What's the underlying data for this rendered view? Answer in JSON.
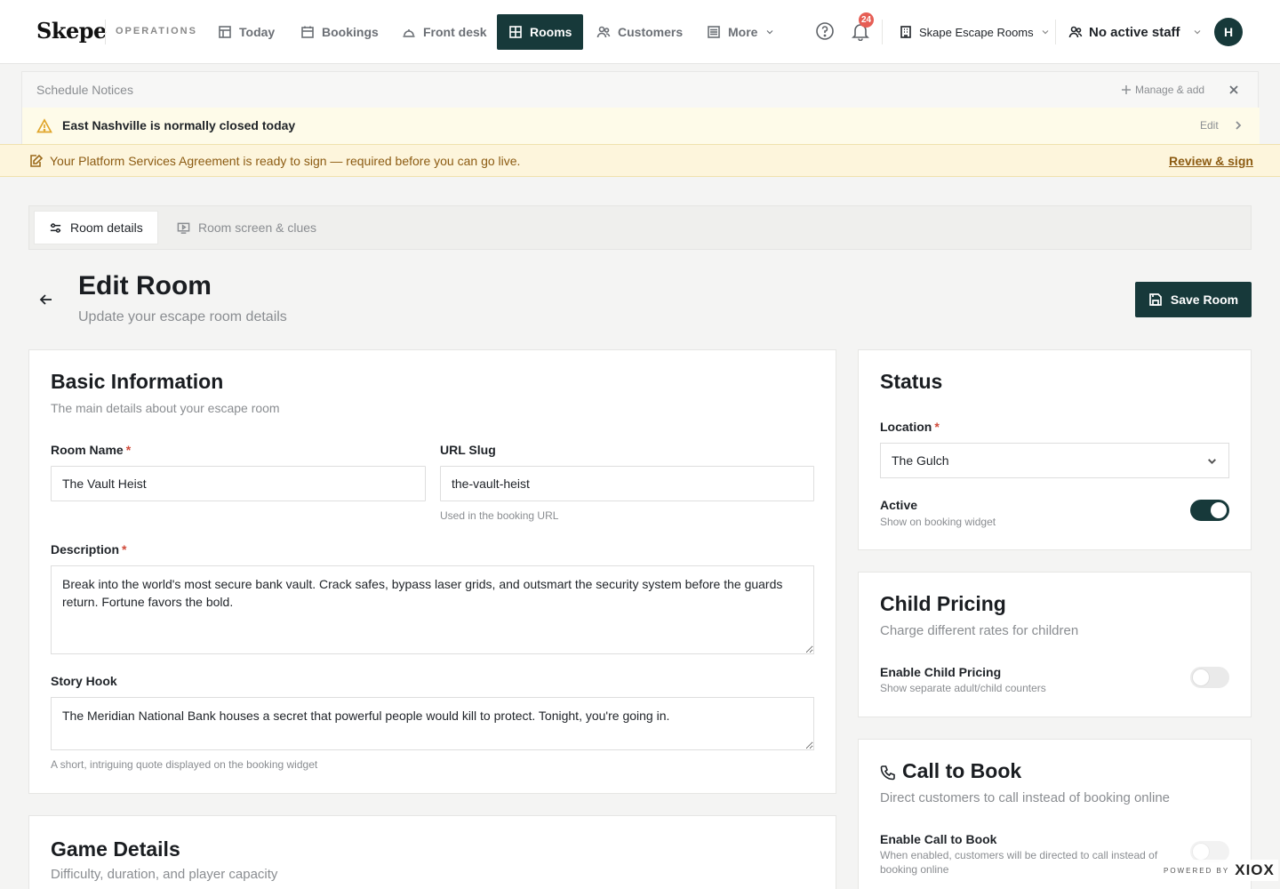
{
  "brand": {
    "name": "Skepe",
    "section": "OPERATIONS"
  },
  "nav": {
    "items": [
      {
        "label": "Today",
        "icon": "table-icon"
      },
      {
        "label": "Bookings",
        "icon": "calendar-icon"
      },
      {
        "label": "Front desk",
        "icon": "bell-desk-icon"
      },
      {
        "label": "Rooms",
        "icon": "grid-icon"
      },
      {
        "label": "Customers",
        "icon": "users-icon"
      },
      {
        "label": "More",
        "icon": "list-icon"
      }
    ],
    "notification_count": "24",
    "business": "Skape Escape Rooms",
    "staff": "No active staff",
    "avatar_initial": "H"
  },
  "notices": {
    "title": "Schedule Notices",
    "manage_label": "Manage & add",
    "notice_text": "East Nashville is normally closed today",
    "edit_label": "Edit"
  },
  "agreement": {
    "text": "Your Platform Services Agreement is ready to sign — required before you can go live.",
    "action": "Review & sign"
  },
  "tabs": [
    {
      "label": "Room details"
    },
    {
      "label": "Room screen & clues"
    }
  ],
  "header": {
    "title": "Edit Room",
    "subtitle": "Update your escape room details",
    "save_label": "Save Room"
  },
  "basic": {
    "title": "Basic Information",
    "subtitle": "The main details about your escape room",
    "room_name_label": "Room Name",
    "room_name_value": "The Vault Heist",
    "slug_label": "URL Slug",
    "slug_value": "the-vault-heist",
    "slug_hint": "Used in the booking URL",
    "description_label": "Description",
    "description_value": "Break into the world's most secure bank vault. Crack safes, bypass laser grids, and outsmart the security system before the guards return. Fortune favors the bold.",
    "story_label": "Story Hook",
    "story_value": "The Meridian National Bank houses a secret that powerful people would kill to protect. Tonight, you're going in.",
    "story_hint": "A short, intriguing quote displayed on the booking widget",
    "required_mark": "*"
  },
  "game": {
    "title": "Game Details",
    "subtitle": "Difficulty, duration, and player capacity"
  },
  "status": {
    "title": "Status",
    "location_label": "Location",
    "location_value": "The Gulch",
    "active_label": "Active",
    "active_sub": "Show on booking widget",
    "active_on": true
  },
  "child": {
    "title": "Child Pricing",
    "subtitle": "Charge different rates for children",
    "enable_label": "Enable Child Pricing",
    "enable_sub": "Show separate adult/child counters",
    "enabled": false
  },
  "call": {
    "title": "Call to Book",
    "subtitle": "Direct customers to call instead of booking online",
    "enable_label": "Enable Call to Book",
    "enable_sub": "When enabled, customers will be directed to call instead of booking online",
    "enabled": false
  },
  "footer": {
    "powered_by": "POWERED BY",
    "powered_brand": "XIOX"
  },
  "colors": {
    "primary": "#17393a",
    "warning": "#e0a52a",
    "danger": "#e65e55",
    "notice_bg": "#fefbe9"
  }
}
